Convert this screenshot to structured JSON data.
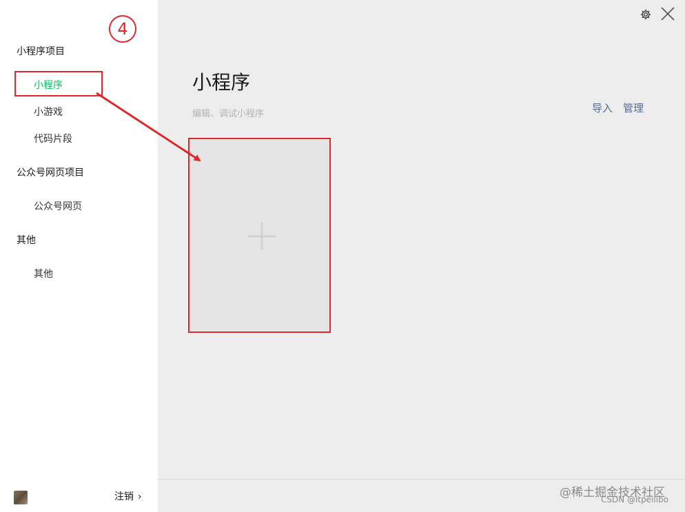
{
  "annotation": {
    "step_number": "4"
  },
  "sidebar": {
    "groups": [
      {
        "heading": "小程序项目",
        "items": [
          "小程序",
          "小游戏",
          "代码片段"
        ]
      },
      {
        "heading": "公众号网页项目",
        "items": [
          "公众号网页"
        ]
      },
      {
        "heading": "其他",
        "items": [
          "其他"
        ]
      }
    ],
    "active_item": "小程序",
    "logout_label": "注销",
    "logout_chevron": "›"
  },
  "main": {
    "title": "小程序",
    "subtitle": "编辑、调试小程序",
    "import_label": "导入",
    "manage_label": "管理",
    "add_symbol": "+"
  },
  "watermark": {
    "line1": "@稀土掘金技术社区",
    "line2": "CSDN @itpeilibo"
  },
  "colors": {
    "accent_green": "#07c160",
    "link_blue": "#576b95",
    "annotation_red": "#e0252b"
  },
  "icons": {
    "settings": "gear-icon",
    "close": "close-icon",
    "chevron": "chevron-right-icon"
  }
}
